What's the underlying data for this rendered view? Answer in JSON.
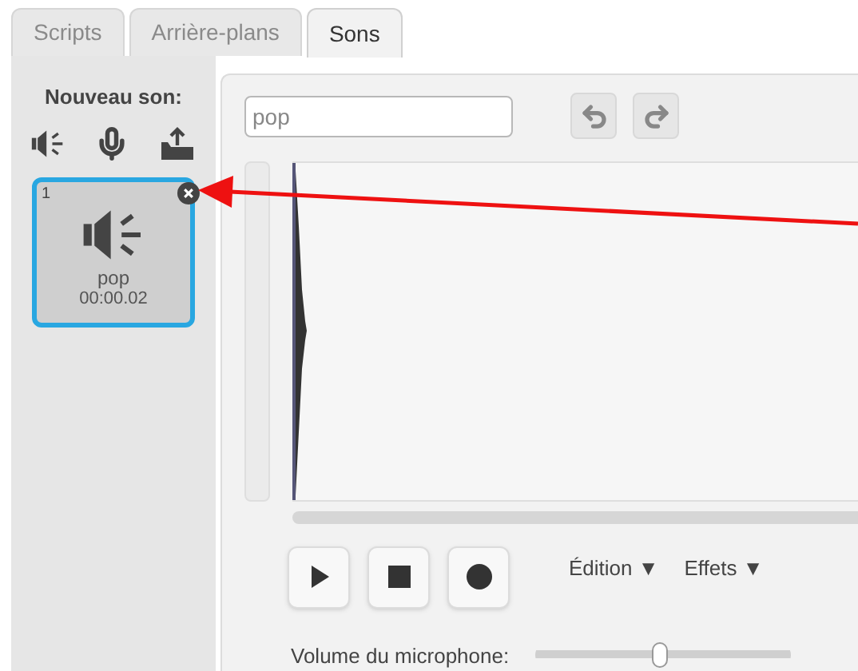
{
  "tabs": [
    {
      "label": "Scripts",
      "selected": false
    },
    {
      "label": "Arrière-plans",
      "selected": false
    },
    {
      "label": "Sons",
      "selected": true
    }
  ],
  "new_sound": {
    "label": "Nouveau son:"
  },
  "sounds": [
    {
      "number": "1",
      "name": "pop",
      "duration": "00:00.02",
      "selected": true
    }
  ],
  "editor": {
    "name_value": "pop",
    "menus": [
      "Édition ▼",
      "Effets ▼"
    ],
    "microphone": {
      "label": "Volume du microphone:",
      "level": 0.49
    }
  }
}
